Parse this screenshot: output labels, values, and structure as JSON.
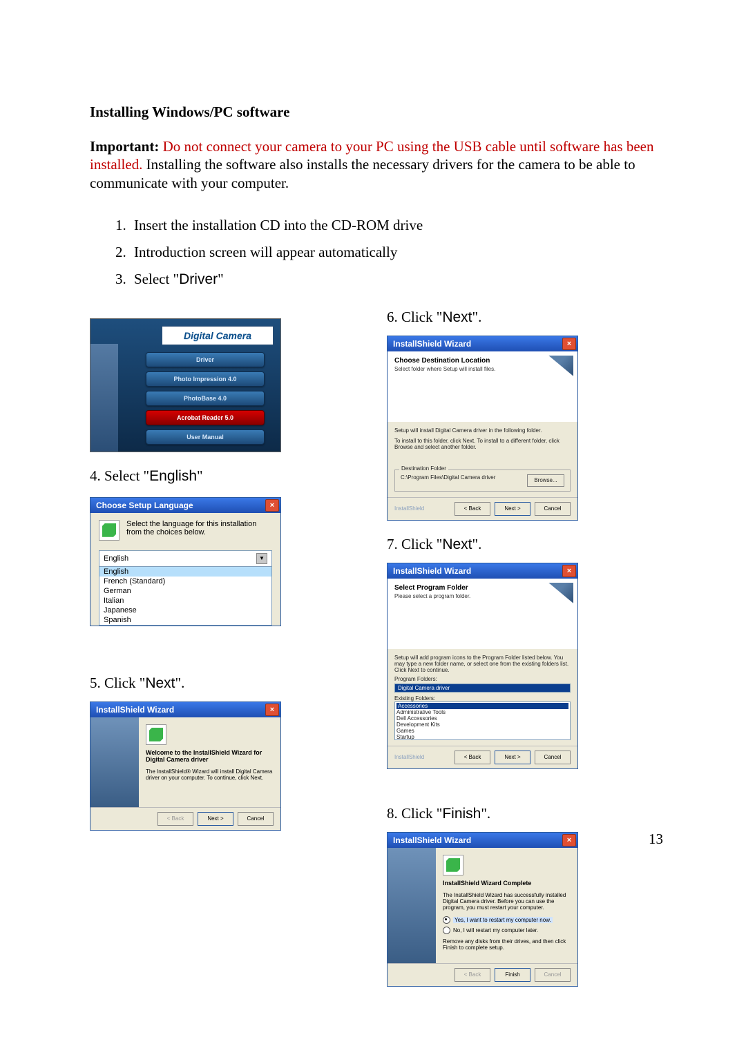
{
  "title": "Installing Windows/PC software",
  "intro": {
    "label": "Important:",
    "warning": " Do not connect your camera to your PC using the USB cable until software has been installed.",
    "rest": "  Installing the software also installs the necessary drivers for the camera to be able to communicate with your computer."
  },
  "top_steps": [
    "Insert the installation CD into the CD-ROM drive",
    "Introduction screen will appear automatically",
    "Select \""
  ],
  "step3_quoted": "Driver",
  "step3_tail": "\"",
  "cd_menu": {
    "title": "Digital Camera",
    "items": [
      "Driver",
      "Photo Impression 4.0",
      "PhotoBase 4.0",
      "Acrobat Reader 5.0",
      "User Manual"
    ]
  },
  "left": {
    "step4_pre": "4.   Select \"",
    "step4_q": "English",
    "step4_post": "\"",
    "lang_dialog": {
      "title": "Choose Setup Language",
      "prompt": "Select the language for this installation from the choices below.",
      "selected": "English",
      "options": [
        "English",
        "French (Standard)",
        "German",
        "Italian",
        "Japanese",
        "Spanish"
      ]
    },
    "step5_pre": "5.   Click \"",
    "step5_q": "Next",
    "step5_post": "\".",
    "welcome": {
      "titlebar": "InstallShield Wizard",
      "h": "Welcome to the InstallShield Wizard for Digital Camera driver",
      "p": "The InstallShield® Wizard will install Digital Camera driver on your computer. To continue, click Next.",
      "back": "< Back",
      "next": "Next >",
      "cancel": "Cancel"
    }
  },
  "right": {
    "step6_pre": "6.   Click \"",
    "step6_q": "Next",
    "step6_post": "\".",
    "dest": {
      "titlebar": "InstallShield Wizard",
      "h": "Choose Destination Location",
      "sub": "Select folder where Setup will install files.",
      "line1": "Setup will install Digital Camera driver in the following folder.",
      "line2": "To install to this folder, click Next. To install to a different folder, click Browse and select another folder.",
      "dest_legend": "Destination Folder",
      "dest_path": "C:\\Program Files\\Digital Camera driver",
      "browse": "Browse...",
      "brand": "InstallShield",
      "back": "< Back",
      "next": "Next >",
      "cancel": "Cancel"
    },
    "step7_pre": "7.   Click \"",
    "step7_q": "Next",
    "step7_post": "\".",
    "pf": {
      "titlebar": "InstallShield Wizard",
      "h": "Select Program Folder",
      "sub": "Please select a program folder.",
      "desc": "Setup will add program icons to the Program Folder listed below. You may type a new folder name, or select one from the existing folders list. Click Next to continue.",
      "pf_label": "Program Folders:",
      "pf_value": "Digital Camera driver",
      "ef_label": "Existing Folders:",
      "ef": [
        "Accessories",
        "Administrative Tools",
        "Dell Accessories",
        "Development Kits",
        "Games",
        "Startup"
      ],
      "brand": "InstallShield",
      "back": "< Back",
      "next": "Next >",
      "cancel": "Cancel"
    },
    "step8_pre": "8.   Click \"",
    "step8_q": "Finish",
    "step8_post": "\".",
    "done": {
      "titlebar": "InstallShield Wizard",
      "h": "InstallShield Wizard Complete",
      "p": "The InstallShield Wizard has successfully installed Digital Camera driver. Before you can use the program, you must restart your computer.",
      "r1": "Yes, I want to restart my computer now.",
      "r2": "No, I will restart my computer later.",
      "p2": "Remove any disks from their drives, and then click Finish to complete setup.",
      "back": "< Back",
      "finish": "Finish",
      "cancel": "Cancel"
    }
  },
  "page_number": "13"
}
